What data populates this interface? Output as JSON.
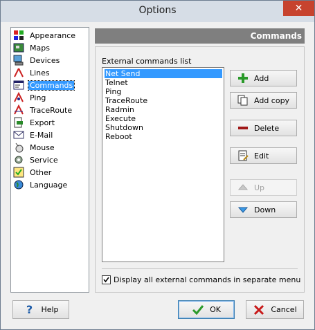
{
  "window": {
    "title": "Options"
  },
  "nav": {
    "items": [
      {
        "label": "Appearance",
        "icon": "appearance-icon"
      },
      {
        "label": "Maps",
        "icon": "maps-icon"
      },
      {
        "label": "Devices",
        "icon": "devices-icon"
      },
      {
        "label": "Lines",
        "icon": "lines-icon"
      },
      {
        "label": "Commands",
        "icon": "commands-icon",
        "selected": true
      },
      {
        "label": "Ping",
        "icon": "ping-icon"
      },
      {
        "label": "TraceRoute",
        "icon": "traceroute-icon"
      },
      {
        "label": "Export",
        "icon": "export-icon"
      },
      {
        "label": "E-Mail",
        "icon": "email-icon"
      },
      {
        "label": "Mouse",
        "icon": "mouse-icon"
      },
      {
        "label": "Service",
        "icon": "service-icon"
      },
      {
        "label": "Other",
        "icon": "other-icon"
      },
      {
        "label": "Language",
        "icon": "language-icon"
      }
    ]
  },
  "panel": {
    "header": "Commands",
    "list_label": "External commands list",
    "commands": [
      "Net Send",
      "Telnet",
      "Ping",
      "TraceRoute",
      "Radmin",
      "Execute",
      "Shutdown",
      "Reboot"
    ],
    "selected_command": "Net Send"
  },
  "buttons": {
    "add": "Add",
    "add_copy": "Add copy",
    "delete": "Delete",
    "edit": "Edit",
    "up": "Up",
    "down": "Down"
  },
  "option": {
    "label": "Display all external commands in separate menu",
    "checked": true
  },
  "footer": {
    "help": "Help",
    "ok": "OK",
    "cancel": "Cancel"
  },
  "colors": {
    "selection": "#3399ff",
    "header_bg": "#7f7f7f",
    "close_button": "#c7432e"
  }
}
